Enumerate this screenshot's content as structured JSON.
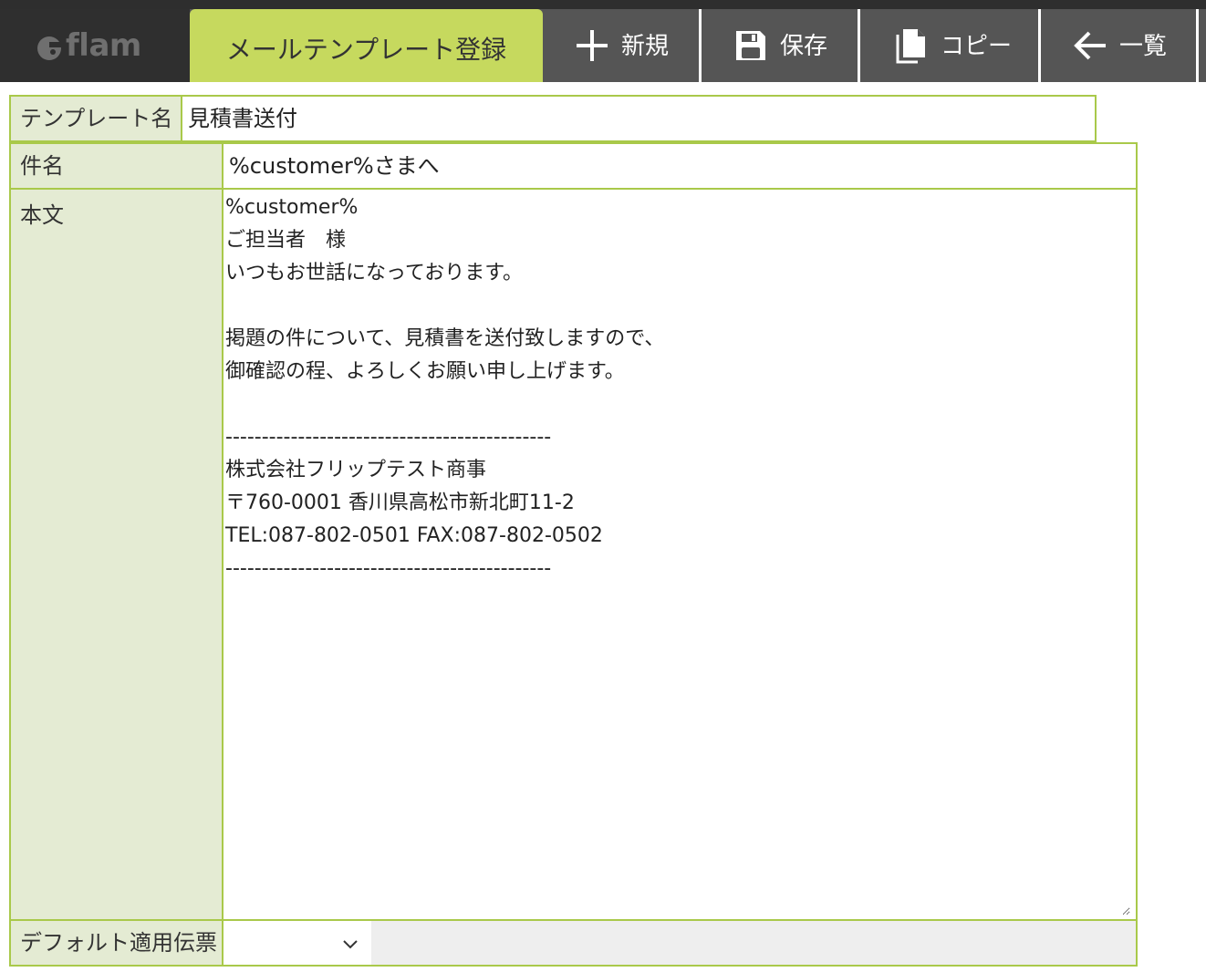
{
  "app": {
    "logo_text": "flam"
  },
  "header": {
    "title": "メールテンプレート登録",
    "buttons": {
      "new_label": "新規",
      "save_label": "保存",
      "copy_label": "コピー",
      "list_label": "一覧"
    }
  },
  "form": {
    "template_name": {
      "label": "テンプレート名",
      "value": "見積書送付"
    },
    "subject": {
      "label": "件名",
      "value": "%customer%さまへ"
    },
    "body": {
      "label": "本文",
      "value": "%customer%\nご担当者　様\nいつもお世話になっております。\n\n掲題の件について、見積書を送付致しますので、\n御確認の程、よろしくお願い申し上げます。\n\n---------------------------------------------\n株式会社フリップテスト商事\n〒760-0001 香川県高松市新北町11-2\nTEL:087-802-0501 FAX:087-802-0502\n---------------------------------------------"
    },
    "default_slip": {
      "label": "デフォルト適用伝票",
      "selected": ""
    }
  },
  "colors": {
    "accent": "#c6d95e",
    "border": "#a9c94a",
    "label_bg": "#e4ebd3",
    "toolbar_bg": "#555555",
    "logo_bg": "#2f2f2f"
  },
  "icons": [
    "plus-icon",
    "save-icon",
    "copy-icon",
    "arrow-left-icon",
    "chevron-down-icon",
    "logo-icon"
  ]
}
